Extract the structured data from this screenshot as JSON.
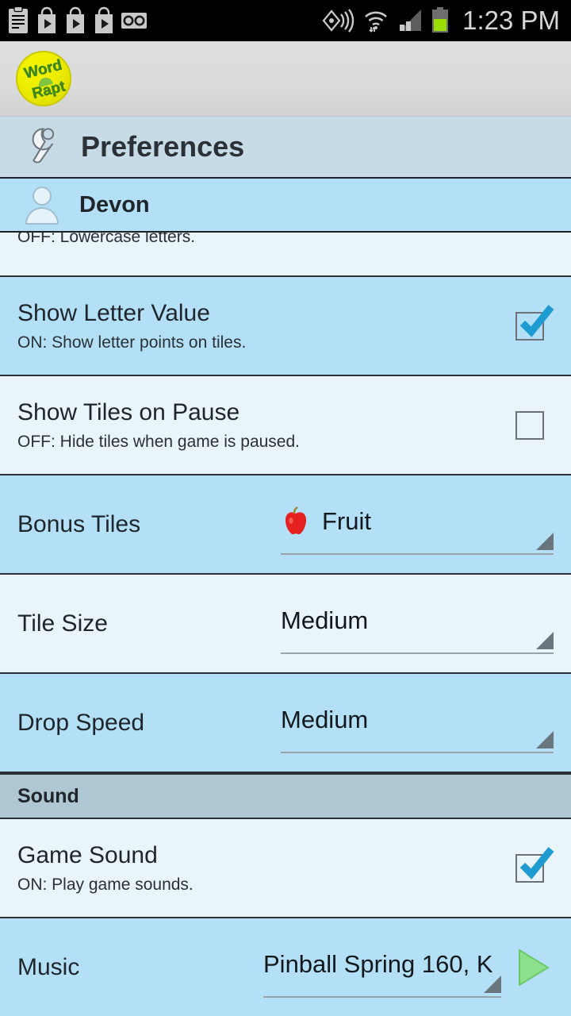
{
  "status_bar": {
    "time": "1:23 PM",
    "left_icons": [
      "clipboard-icon",
      "play-store-icon",
      "play-store-icon",
      "play-store-icon",
      "voicemail-icon"
    ],
    "right_icons": [
      "gps-icon",
      "wifi-icon",
      "signal-icon",
      "battery-icon"
    ],
    "background": "#000000",
    "text_color": "#d6d6d6"
  },
  "app_bar": {
    "logo_line1": "Word",
    "logo_line2": "Rapt",
    "logo_color": "#ebeb00",
    "logo_text_color": "#3f8a1e",
    "background": "#dcdcdc"
  },
  "header": {
    "icon": "wrench-icon",
    "title": "Preferences",
    "background": "#c6dbe6"
  },
  "user": {
    "icon": "person-icon",
    "name": "Devon",
    "background": "#b3e0f7"
  },
  "colors": {
    "row_alt": "#b3e0f7",
    "row_plain": "#e9f4fb",
    "section_header": "#aec7d3",
    "divider": "#2c3137",
    "checkbox_tick": "#1e9bd0",
    "play_button": "#7ee07e"
  },
  "rows": [
    {
      "name": "partial-row",
      "title": "",
      "sub": "OFF: Lowercase letters.",
      "type": "partial"
    },
    {
      "name": "show-letter-value",
      "title": "Show Letter Value",
      "sub": "ON:  Show letter points on tiles.",
      "type": "checkbox",
      "checked": true
    },
    {
      "name": "show-tiles-on-pause",
      "title": "Show Tiles on Pause",
      "sub": "OFF: Hide tiles when game is paused.",
      "type": "checkbox",
      "checked": false
    },
    {
      "name": "bonus-tiles",
      "title": "Bonus Tiles",
      "value": "Fruit",
      "icon": "apple-icon",
      "type": "spinner"
    },
    {
      "name": "tile-size",
      "title": "Tile Size",
      "value": "Medium",
      "type": "spinner"
    },
    {
      "name": "drop-speed",
      "title": "Drop Speed",
      "value": "Medium",
      "type": "spinner"
    }
  ],
  "sound_section": {
    "label": "Sound",
    "game_sound": {
      "title": "Game Sound",
      "sub": "ON:  Play game sounds.",
      "checked": true
    },
    "music": {
      "title": "Music",
      "value": "Pinball Spring 160, K",
      "play_icon": "play-icon"
    }
  }
}
